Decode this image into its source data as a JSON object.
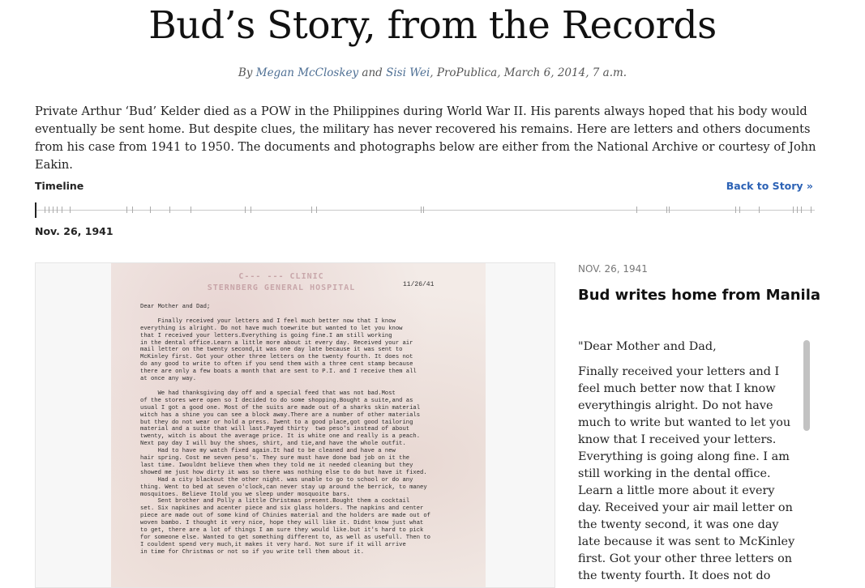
{
  "header": {
    "title": "Bud’s Story, from the Records",
    "byline_prefix": "By",
    "author1": "Megan McCloskey",
    "byline_and": "and",
    "author2": "Sisi Wei",
    "byline_suffix": ", ProPublica, March 6, 2014, 7 a.m."
  },
  "intro": "Private Arthur ‘Bud’ Kelder died as a POW in the Philippines during World War II. His parents always hoped that his body would eventually be sent home. But despite clues, the military has never recovered his remains. Here are letters and others documents from his case from 1941 to 1950. The documents and photographs below are either from the National Archive or courtesy of John Eakin.",
  "timeline": {
    "label": "Timeline",
    "back_link": "Back to Story »",
    "current_date": "Nov. 26, 1941",
    "current_index": 0,
    "tick_count": 24
  },
  "document": {
    "letterhead": "C--- --- CLINIC\nSTERNBERG GENERAL HOSPITAL",
    "date": "11/26/41",
    "body": "Dear Mother and Dad;\n\n     Finally received your letters and I feel much better now that I know\neverything is alright. Do not have much toewrite but wanted to let you know\nthat I received your letters.Everything is going fine.I am still working\nin the dental office.Learn a little more about it every day. Received your air\nmail letter on the twenty second,it was one day late because it was sent to\nMcKinley first. Got your other three letters on the twenty fourth. It does not\ndo any good to write to often if you send them with a three cent stamp because\nthere are only a few boats a month that are sent to P.I. and I receive them all\nat once any way.\n\n     We had thanksgiving day off and a special feed that was not bad.Most\nof the stores were open so I decided to do some shopping.Bought a suite,and as\nusual I got a good one. Most of the suits are made out of a sharks skin material\nwitch has a shine you can see a block away.There are a number of other materials\nbut they do not wear or hold a press. Iwent to a good place,got good tailoring\nmaterial and a suite that will last.Payed thirty  two peso's instead of about\ntwenty, witch is about the average price. It is white one and really is a peach.\nNext pay day I will buy the shoes, shirt, and tie,and have the whole outfit.\n     Had to have my watch fixed again.It had to be cleaned and have a new\nhair spring. Cost me seven peso's. They sure must have done bad job on it the\nlast time. Iwouldnt believe them when they told me it needed cleaning but they\nshowed me just how dirty it was so there was nothing else to do but have it fixed.\n     Had a city blackout the other night. was unable to go to school or do any\nthing. Went to bed at seven o'clock,can never stay up around the berrick, to maney\nmosquitoes. Believe Itold you we sleep under mosquoite bars.\n     Sent brother and Polly a little Christmas present.Bought them a cocktail\nset. Six napkines and acenter piece and six glass holders. The napkins and center\npiece are made out of some kind of Chinies material and the holders are made out of\nwoven bambo. I thought it very nice, hope they will like it. Didnt know just what\nto get, there are a lot of things I am sure they would like.but it's hard to pick\nfor someone else. Wanted to get something different to, as well as usefull. Then to\nI couldent spend very much,it makes it very hard. Not sure if it will arrive\nin time for Christmas or not so if you write tell them about it."
  },
  "entry": {
    "date": "NOV. 26, 1941",
    "title": "Bud writes home from Manila",
    "paragraph1": "\"Dear Mother and Dad,",
    "paragraph2": "Finally received your letters and I feel much better now that I know everythingis alright. Do not have much to write but wanted to let you know that I received your letters. Everything is going along fine. I am still working in the dental office. Learn a little more about it every day. Received your air mail letter on the twenty second, it was one day late because it was sent to McKinley first. Got your other three letters on the twenty fourth. It does not do"
  }
}
